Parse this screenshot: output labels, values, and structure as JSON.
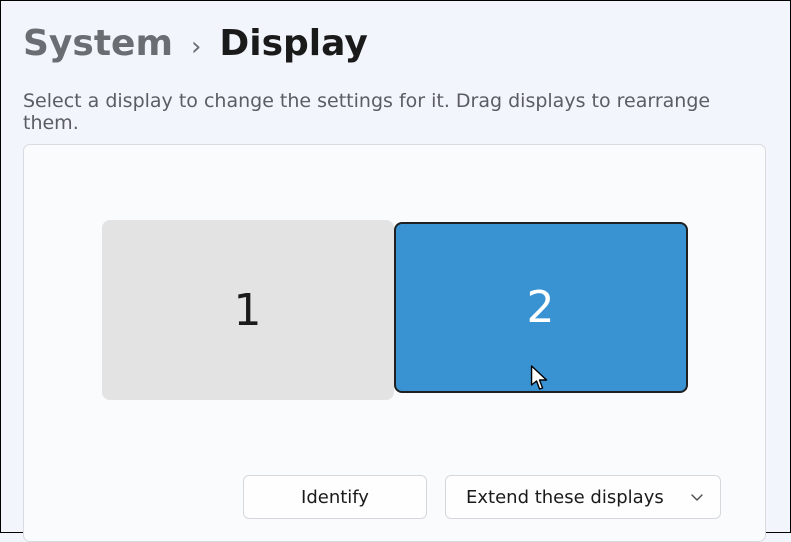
{
  "breadcrumb": {
    "parent": "System",
    "current": "Display"
  },
  "helper_text": "Select a display to change the settings for it. Drag displays to rearrange them.",
  "monitors": [
    {
      "id": "1",
      "label": "1",
      "selected": false
    },
    {
      "id": "2",
      "label": "2",
      "selected": true
    }
  ],
  "controls": {
    "identify_label": "Identify",
    "extend_label": "Extend these displays"
  }
}
